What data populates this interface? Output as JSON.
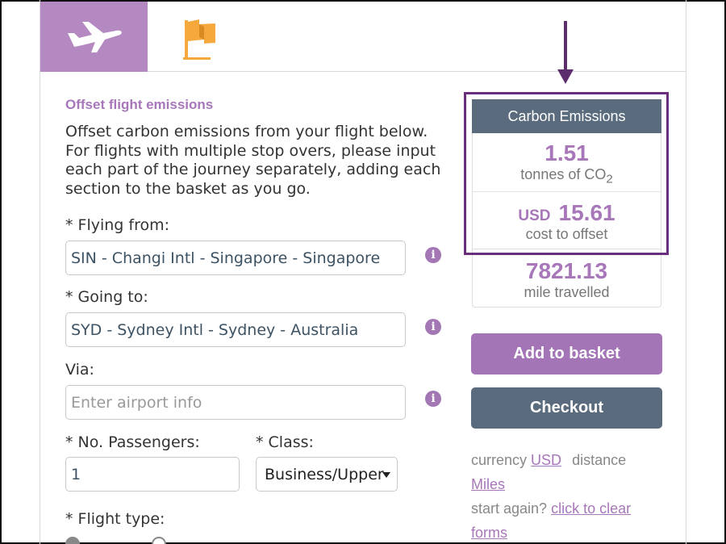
{
  "tabs": [
    {
      "icon": "airplane-icon",
      "active": true
    },
    {
      "icon": "flag-icon",
      "active": false
    }
  ],
  "colors": {
    "accent": "#a777b9",
    "header": "#5a6b7d",
    "highlight": "#6a2e7d",
    "tab_active": "#b488c0",
    "flag": "#f5a93c"
  },
  "form": {
    "heading": "Offset flight emissions",
    "description": "Offset carbon emissions from your flight below. For flights with multiple stop overs, please input each part of the journey separately, adding each section to the basket as you go.",
    "from_label": "* Flying from:",
    "from_value": "SIN - Changi Intl - Singapore - Singapore",
    "to_label": "* Going to:",
    "to_value": "SYD - Sydney Intl - Sydney - Australia",
    "via_label": "Via:",
    "via_placeholder": "Enter airport info",
    "passengers_label": "* No. Passengers:",
    "passengers_value": "1",
    "class_label": "* Class:",
    "class_value": "Business/Upper",
    "flight_type_label": "* Flight type:"
  },
  "emissions": {
    "header": "Carbon Emissions",
    "tonnes_value": "1.51",
    "tonnes_unit_prefix": "tonnes of CO",
    "tonnes_unit_sub": "2",
    "currency": "USD",
    "cost_value": "15.61",
    "cost_label": "cost to offset",
    "distance_value": "7821.13",
    "distance_label": "mile travelled"
  },
  "buttons": {
    "add": "Add to basket",
    "checkout": "Checkout"
  },
  "settings": {
    "currency_label": "currency",
    "currency_link": "USD",
    "distance_label": "distance",
    "distance_link": "Miles",
    "restart_label": "start again?",
    "restart_link_1": "click to clear",
    "restart_link_2": "forms"
  }
}
